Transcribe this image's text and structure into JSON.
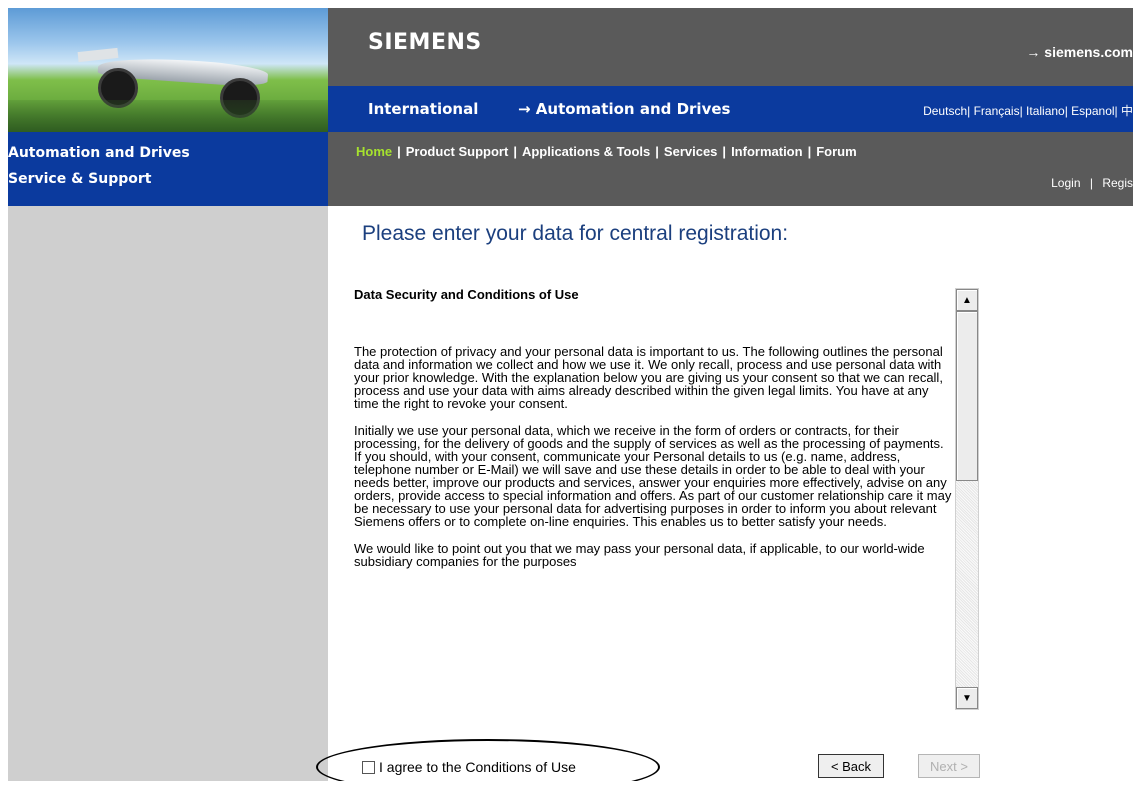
{
  "header": {
    "brand": "SIEMENS",
    "external_link": "→ siemens.com",
    "international": "International",
    "division_link": "→ Automation and Drives",
    "languages": "Deutsch| Français| Italiano| Espanol| 中"
  },
  "sidebar": {
    "line1": "Automation and Drives",
    "line2": "Service & Support"
  },
  "nav": {
    "home": "Home",
    "product_support": "Product Support",
    "applications_tools": "Applications & Tools",
    "services": "Services",
    "information": "Information",
    "forum": "Forum",
    "separator": "|",
    "login": "Login",
    "register": "Regis"
  },
  "main": {
    "heading": "Please enter your data for central registration:",
    "terms_title": "Data Security and Conditions of Use",
    "terms_paragraphs": [
      "The protection of privacy and your personal data is important to us. The following outlines the personal data and information we collect and how we use it. We only recall, process and use personal data with your prior knowledge. With the explanation below you are giving us your consent so that we can recall, process and use your data with aims already described within the given legal limits. You have at any time the right to revoke your consent.",
      "Initially we use your personal data, which we receive in the form of orders or contracts, for their processing, for the delivery of goods and the supply of services as well as the processing of payments. If you should, with your consent, communicate your Personal details to us (e.g. name, address, telephone number or E-Mail) we will save and use these details in order to be able to deal with your needs better, improve our products and services, answer your enquiries more effectively, advise on any orders, provide access to special information and offers. As part of our customer relationship care it may be necessary to use your personal data for advertising purposes in order to inform you about relevant Siemens offers or to complete on-line enquiries. This enables us to better satisfy your needs.",
      "We would like to point out you that we may pass your personal data, if applicable, to our world-wide subsidiary companies for the purposes"
    ],
    "agree_label": "I agree to the Conditions of Use",
    "back_label": "< Back",
    "next_label": "Next >"
  }
}
